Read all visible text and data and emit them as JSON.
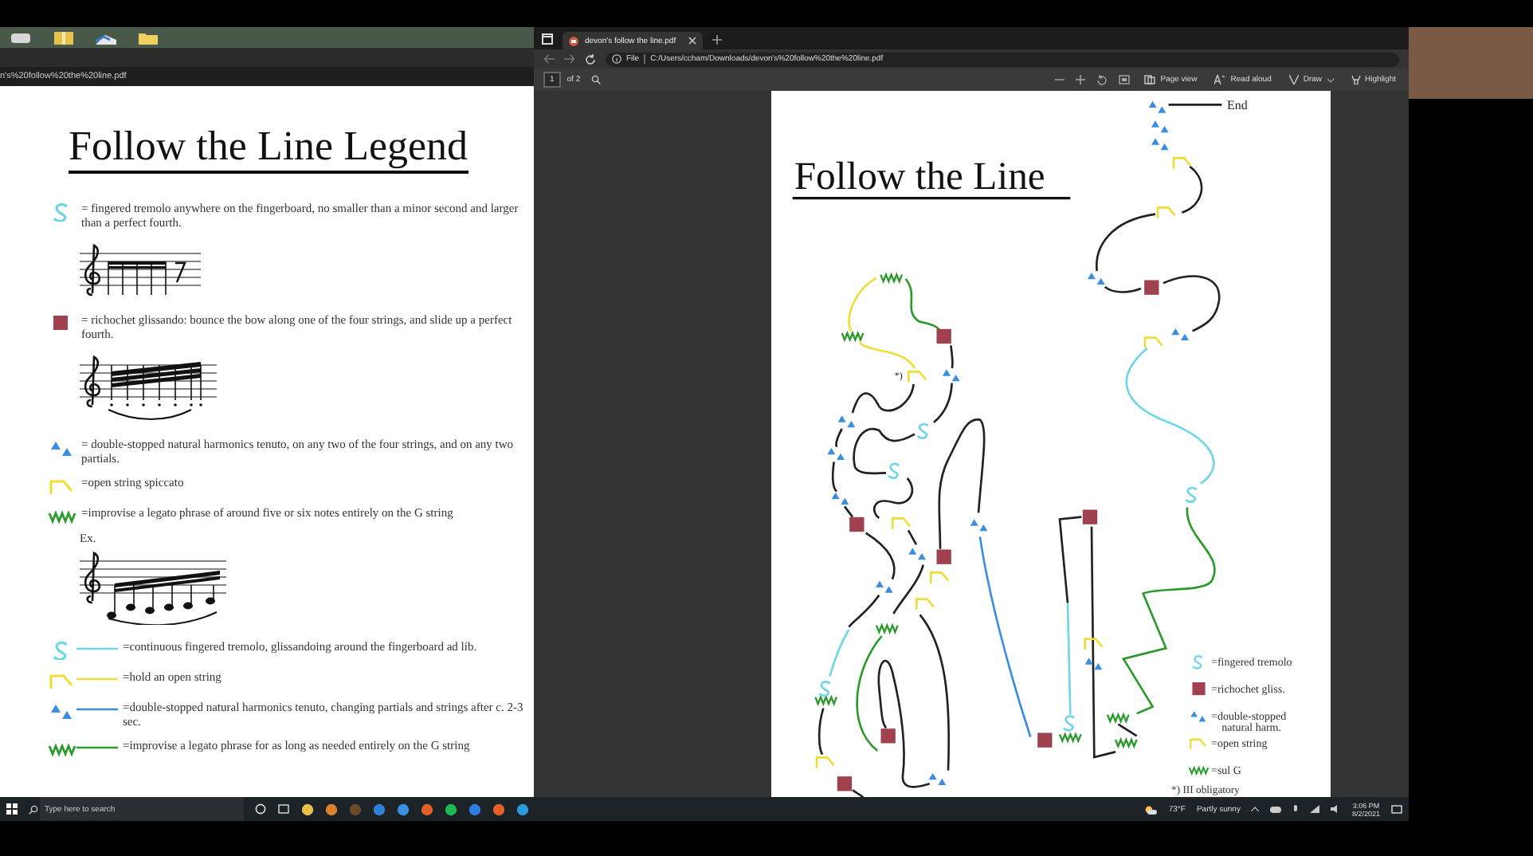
{
  "left_window": {
    "address": "n's%20follow%20the%20line.pdf",
    "page": {
      "title": "Follow the Line Legend",
      "entries": [
        {
          "kind": "tremolo",
          "continuous": false,
          "text": "= fingered tremolo anywhere on the fingerboard, no smaller than a minor second and larger than a perfect fourth.",
          "example": {
            "kind": "tremolo"
          }
        },
        {
          "kind": "ricochet",
          "continuous": false,
          "text": "= richochet glissando: bounce the bow along one of the four strings, and slide up a perfect fourth.",
          "example": {
            "kind": "ricochet"
          }
        },
        {
          "kind": "harmonics",
          "continuous": false,
          "text": "= double-stopped natural harmonics tenuto, on any two of the four strings, and on any two partials."
        },
        {
          "kind": "open",
          "continuous": false,
          "text": "=open string spiccato"
        },
        {
          "kind": "sulg",
          "continuous": false,
          "text": "=improvise a legato phrase of around five or six notes entirely on the G string",
          "example": {
            "label": "Ex.",
            "kind": "phrase"
          }
        },
        {
          "kind": "tremolo",
          "continuous": true,
          "text": "=continuous fingered tremolo, glissandoing around the fingerboard ad lib."
        },
        {
          "kind": "open",
          "continuous": true,
          "text": "=hold an open string"
        },
        {
          "kind": "harmonics",
          "continuous": true,
          "text": "=double-stopped natural harmonics tenuto, changing partials and strings after c. 2-3 sec."
        },
        {
          "kind": "sulg",
          "continuous": true,
          "text": "=improvise a legato phrase for as long as needed entirely on the G string"
        }
      ]
    }
  },
  "right_window": {
    "tab": {
      "title": "devon's follow the line.pdf",
      "selected": true
    },
    "address": {
      "protocol": "File",
      "path": "C:/Users/ccham/Downloads/devon's%20follow%20the%20line.pdf"
    },
    "toolbar": {
      "page": "1",
      "page_count": "of 2",
      "tools": [
        {
          "kind": "page-view",
          "label": "Page view"
        },
        {
          "kind": "read-aloud",
          "label": "Read aloud"
        },
        {
          "kind": "draw",
          "label": "Draw"
        },
        {
          "kind": "highlight",
          "label": "Highlight"
        }
      ]
    },
    "page": {
      "title": "Follow the Line",
      "end_label": "End",
      "note_mark": "*)",
      "legend": [
        {
          "kind": "tremolo",
          "text": "=fingered tremolo"
        },
        {
          "kind": "ricochet",
          "text": "=richochet gliss."
        },
        {
          "kind": "harmonics",
          "text": "=double-stopped natural harm."
        },
        {
          "kind": "open",
          "text": "=open string"
        },
        {
          "kind": "sulg",
          "text": "=sul G"
        }
      ],
      "footnote": "*) III obligatory"
    }
  },
  "taskbar": {
    "search_placeholder": "Type here to search",
    "temperature": "73°F",
    "weather": "Partly sunny",
    "time": "3:06 PM",
    "date": "8/2/2021"
  }
}
